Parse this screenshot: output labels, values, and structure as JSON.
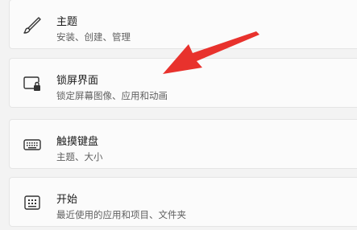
{
  "settings_list": {
    "items": [
      {
        "icon": "brush-icon",
        "title": "主题",
        "description": "安装、创建、管理"
      },
      {
        "icon": "lock-screen-icon",
        "title": "锁屏界面",
        "description": "锁定屏幕图像、应用和动画"
      },
      {
        "icon": "keyboard-icon",
        "title": "触摸键盘",
        "description": "主题、大小"
      },
      {
        "icon": "start-menu-icon",
        "title": "开始",
        "description": "最近使用的应用和项目、文件夹"
      }
    ]
  },
  "annotation": {
    "arrow_color": "#e8322d"
  }
}
